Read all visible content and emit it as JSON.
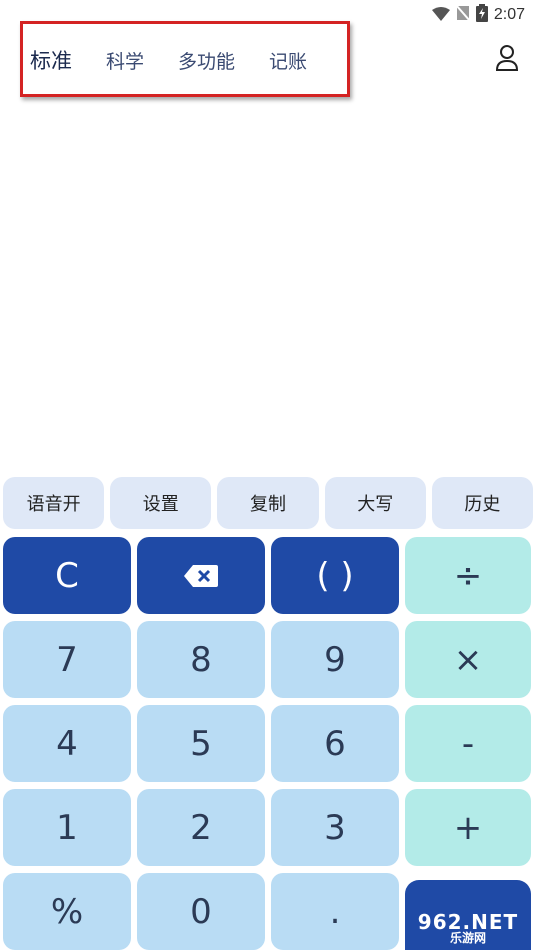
{
  "status_bar": {
    "time": "2:07",
    "icons": [
      "wifi-icon",
      "no-signal-icon",
      "battery-charging-icon"
    ]
  },
  "tabs": [
    {
      "label": "标准",
      "active": true
    },
    {
      "label": "科学",
      "active": false
    },
    {
      "label": "多功能",
      "active": false
    },
    {
      "label": "记账",
      "active": false
    }
  ],
  "header": {
    "user_icon": "user-icon"
  },
  "function_buttons": [
    {
      "label": "语音开"
    },
    {
      "label": "设置"
    },
    {
      "label": "复制"
    },
    {
      "label": "大写"
    },
    {
      "label": "历史"
    }
  ],
  "keypad": {
    "clear": "C",
    "backspace_icon": "backspace-icon",
    "parentheses": "( )",
    "divide": "÷",
    "multiply": "×",
    "minus": "-",
    "plus": "+",
    "percent": "%",
    "dot": ".",
    "digits": {
      "zero": "0",
      "one": "1",
      "two": "2",
      "three": "3",
      "four": "4",
      "five": "5",
      "six": "6",
      "seven": "7",
      "eight": "8",
      "nine": "9"
    }
  },
  "watermark": {
    "top": "962.NET",
    "bottom": "乐游网"
  },
  "colors": {
    "accent_dark": "#1f4aa6",
    "digit_key": "#b9dcf4",
    "operator_key": "#b3ebe8",
    "function_key": "#dfe8f7",
    "highlight_border": "#d42323"
  }
}
